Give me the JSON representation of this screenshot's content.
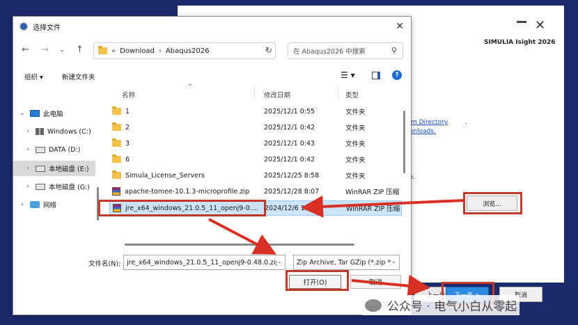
{
  "installer": {
    "product_title": "SIMULIA Isight 2026",
    "link_directory": "m Directory",
    "link_downloads": "wnloads.",
    "text_fragment": "e.",
    "browse_label": "浏览...",
    "prev_label": "上一步",
    "next_label": "下一步 >",
    "cancel_label": "取消"
  },
  "dialog": {
    "title": "选择文件",
    "address": {
      "overflow": "«",
      "crumbs": [
        "Download",
        "Abaqus2026"
      ]
    },
    "search_placeholder": "在 Abaqus2026 中搜索",
    "toolbar": {
      "organize": "组织 ▾",
      "new_folder": "新建文件夹"
    },
    "nav_items": [
      {
        "label": "此电脑",
        "chevron": "⌄",
        "icon": "pc-icon"
      },
      {
        "label": "Windows (C:)",
        "chevron": "›",
        "icon": "drive-c-icon"
      },
      {
        "label": "DATA (D:)",
        "chevron": "›",
        "icon": "drive-d-icon"
      },
      {
        "label": "本地磁盘 (E:)",
        "chevron": "›",
        "icon": "drive-e-icon"
      },
      {
        "label": "本地磁盘 (G:)",
        "chevron": "›",
        "icon": "drive-g-icon"
      },
      {
        "label": "网络",
        "chevron": "›",
        "icon": "network-icon"
      }
    ],
    "columns": {
      "name": "名称",
      "date": "修改日期",
      "type": "类型"
    },
    "files": [
      {
        "name": "1",
        "date": "2025/12/1 0:55",
        "type": "文件夹",
        "kind": "folder"
      },
      {
        "name": "2",
        "date": "2025/12/1 0:42",
        "type": "文件夹",
        "kind": "folder"
      },
      {
        "name": "3",
        "date": "2025/12/1 0:43",
        "type": "文件夹",
        "kind": "folder"
      },
      {
        "name": "6",
        "date": "2025/12/1 0:42",
        "type": "文件夹",
        "kind": "folder"
      },
      {
        "name": "Simula_License_Servers",
        "date": "2025/12/25 8:58",
        "type": "文件夹",
        "kind": "folder"
      },
      {
        "name": "apache-tomee-10.1.3-microprofile.zip",
        "date": "2025/12/28 8:07",
        "type": "WinRAR ZIP 压缩",
        "kind": "zip"
      },
      {
        "name": "jre_x64_windows_21.0.5_11_openj9-0....",
        "date": "2024/12/6 13:03",
        "type": "WinRAR ZIP 压缩",
        "kind": "zip"
      }
    ],
    "filename_label": "文件名(N):",
    "filename_value": "jre_x64_windows_21.0.5_11_openj9-0.48.0.zip",
    "filter_value": "Zip Archive, Tar GZip (*.zip *",
    "open_label": "打开(O)",
    "cancel_label": "取消"
  },
  "watermark": "公众号 · 电气小白从零起"
}
